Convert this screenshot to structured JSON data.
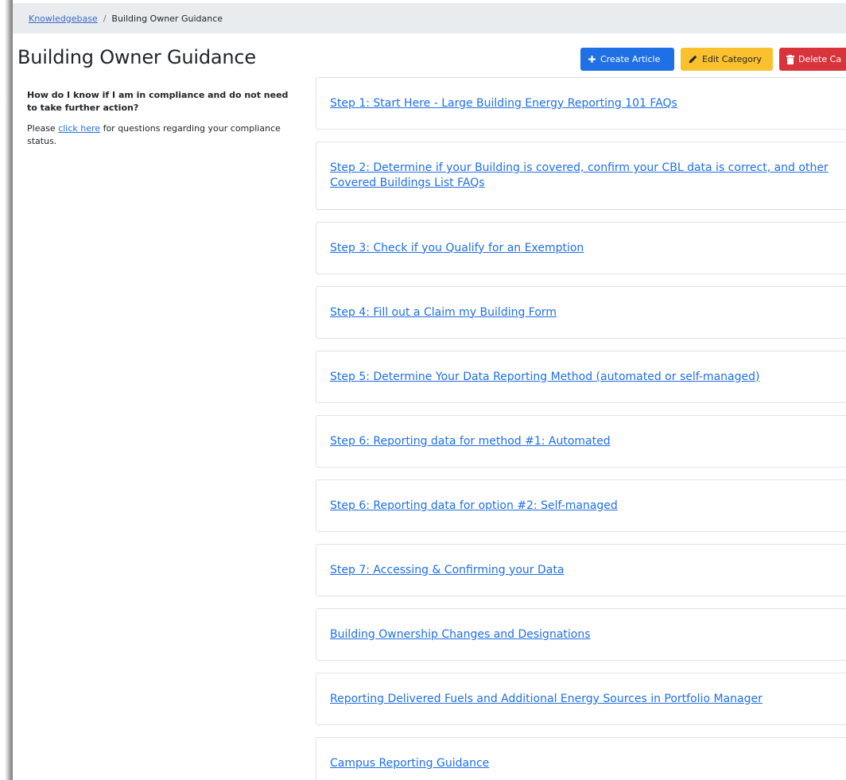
{
  "breadcrumb": {
    "home_label": "Knowledgebase",
    "separator": "/",
    "current_label": "Building Owner Guidance"
  },
  "page": {
    "title": "Building Owner Guidance"
  },
  "toolbar": {
    "create_label": "Create Article",
    "edit_label": "Edit Category",
    "delete_label": "Delete Ca"
  },
  "sidebar": {
    "question": "How do I know if I am in compliance and do not need to take further action?",
    "answer_prefix": "Please ",
    "answer_link": "click here",
    "answer_suffix": " for questions regarding your compliance status."
  },
  "articles": [
    {
      "title": "Step 1: Start Here - Large Building Energy Reporting 101 FAQs"
    },
    {
      "title": "Step 2: Determine if your Building is covered, confirm your CBL data is correct, and other Covered Buildings List FAQs"
    },
    {
      "title": "Step 3: Check if you Qualify for an Exemption"
    },
    {
      "title": "Step 4: Fill out a Claim my Building Form"
    },
    {
      "title": "Step 5: Determine Your Data Reporting Method (automated or self-managed)"
    },
    {
      "title": "Step 6: Reporting data for method #1: Automated"
    },
    {
      "title": "Step 6: Reporting data for option #2: Self-managed"
    },
    {
      "title": "Step 7: Accessing & Confirming your Data"
    },
    {
      "title": "Building Ownership Changes and Designations"
    },
    {
      "title": "Reporting Delivered Fuels and Additional Energy Sources in Portfolio Manager"
    },
    {
      "title": "Campus Reporting Guidance"
    }
  ],
  "colors": {
    "primary": "#1f6fe5",
    "warning": "#fbc02d",
    "danger": "#d9343c",
    "breadcrumb_bg": "#e9ecef"
  },
  "icons": {
    "create": "plus-icon",
    "edit": "pencil-icon",
    "delete": "trash-icon"
  }
}
